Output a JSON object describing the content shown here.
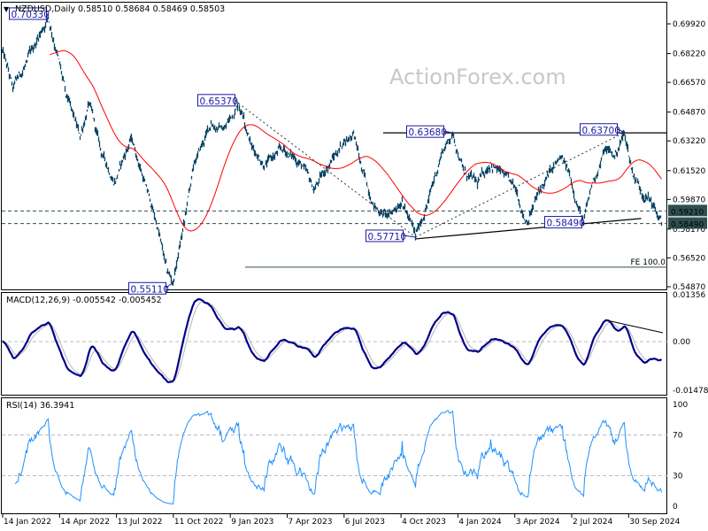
{
  "chart_data": [
    {
      "type": "line",
      "title": "NZDUSD,Daily",
      "ohlc": "0.58510 0.58684 0.58469 0.58503",
      "watermark": "ActionForex.com",
      "ylim": [
        0.543,
        0.7125
      ],
      "yticks": [
        "0.69920",
        "0.68220",
        "0.66570",
        "0.64870",
        "0.63220",
        "0.61520",
        "0.59870",
        "0.58170",
        "0.56520",
        "0.54870"
      ],
      "ytick_values": [
        0.6992,
        0.6822,
        0.6657,
        0.6487,
        0.6322,
        0.6152,
        0.5987,
        0.5817,
        0.5652,
        0.5487
      ],
      "xticks": [
        "14 Jan 2022",
        "14 Apr 2022",
        "13 Jul 2022",
        "11 Oct 2022",
        "9 Jan 2023",
        "7 Apr 2023",
        "6 Jul 2023",
        "4 Oct 2023",
        "4 Jan 2024",
        "3 Apr 2024",
        "2 Jul 2024",
        "30 Sep 2024"
      ],
      "bars_between_xticks": 64.3,
      "price_waypoints": [
        [
          0,
          0.684
        ],
        [
          12,
          0.662
        ],
        [
          28,
          0.677
        ],
        [
          42,
          0.693
        ],
        [
          52,
          0.7033
        ],
        [
          62,
          0.683
        ],
        [
          72,
          0.658
        ],
        [
          88,
          0.634
        ],
        [
          98,
          0.654
        ],
        [
          112,
          0.625
        ],
        [
          127,
          0.609
        ],
        [
          146,
          0.634
        ],
        [
          162,
          0.607
        ],
        [
          176,
          0.582
        ],
        [
          186,
          0.557
        ],
        [
          193,
          0.5511
        ],
        [
          206,
          0.586
        ],
        [
          216,
          0.617
        ],
        [
          236,
          0.642
        ],
        [
          251,
          0.639
        ],
        [
          267,
          0.6537
        ],
        [
          273,
          0.647
        ],
        [
          282,
          0.629
        ],
        [
          297,
          0.619
        ],
        [
          317,
          0.627
        ],
        [
          337,
          0.62
        ],
        [
          352,
          0.604
        ],
        [
          367,
          0.617
        ],
        [
          386,
          0.632
        ],
        [
          397,
          0.637
        ],
        [
          407,
          0.614
        ],
        [
          422,
          0.594
        ],
        [
          437,
          0.589
        ],
        [
          452,
          0.599
        ],
        [
          467,
          0.5771
        ],
        [
          482,
          0.599
        ],
        [
          497,
          0.626
        ],
        [
          509,
          0.6368
        ],
        [
          522,
          0.614
        ],
        [
          537,
          0.607
        ],
        [
          552,
          0.62
        ],
        [
          567,
          0.612
        ],
        [
          582,
          0.602
        ],
        [
          592,
          0.586
        ],
        [
          607,
          0.603
        ],
        [
          622,
          0.616
        ],
        [
          632,
          0.622
        ],
        [
          642,
          0.611
        ],
        [
          657,
          0.5849
        ],
        [
          667,
          0.608
        ],
        [
          682,
          0.628
        ],
        [
          692,
          0.623
        ],
        [
          703,
          0.637
        ],
        [
          712,
          0.615
        ],
        [
          722,
          0.604
        ],
        [
          732,
          0.599
        ],
        [
          745,
          0.585
        ]
      ],
      "moving_average_period": 55,
      "levels": {
        "upper_dashed": 0.5921,
        "lower_dashed": 0.5849,
        "resistance": 0.6368,
        "fe_level": 0.5599
      },
      "level_tags": [
        "0.59210",
        "0.58490"
      ],
      "fe_label": "FE 100.0",
      "annotations": [
        {
          "text": "0.70330",
          "bar": 52,
          "price": 0.7033
        },
        {
          "text": "0.65370",
          "bar": 267,
          "price": 0.6537
        },
        {
          "text": "0.55110",
          "bar": 193,
          "price": 0.5511
        },
        {
          "text": "0.57710",
          "bar": 467,
          "price": 0.5771
        },
        {
          "text": "0.63680",
          "bar": 509,
          "price": 0.6368
        },
        {
          "text": "0.63700",
          "bar": 703,
          "price": 0.637
        },
        {
          "text": "0.58490",
          "bar": 657,
          "price": 0.5849
        }
      ],
      "colors": {
        "price": "#0c4566",
        "ma": "#ff0000",
        "macd": "#00008b",
        "signal": "#b4b4b4",
        "rsi": "#1e90ff",
        "tag_bg": "#2f4f4f"
      }
    },
    {
      "type": "line",
      "title": "MACD(12,26,9) -0.005542 -0.005452",
      "params": [
        12,
        26,
        9
      ],
      "ylim": [
        -0.014783,
        0.01356
      ],
      "yticks": [
        "0.01356",
        "0.00",
        "-0.014783"
      ]
    },
    {
      "type": "line",
      "title": "RSI(14) 36.3941",
      "period": 14,
      "ylim": [
        0,
        100
      ],
      "yticks": [
        "100",
        "70",
        "30",
        "0"
      ]
    }
  ]
}
